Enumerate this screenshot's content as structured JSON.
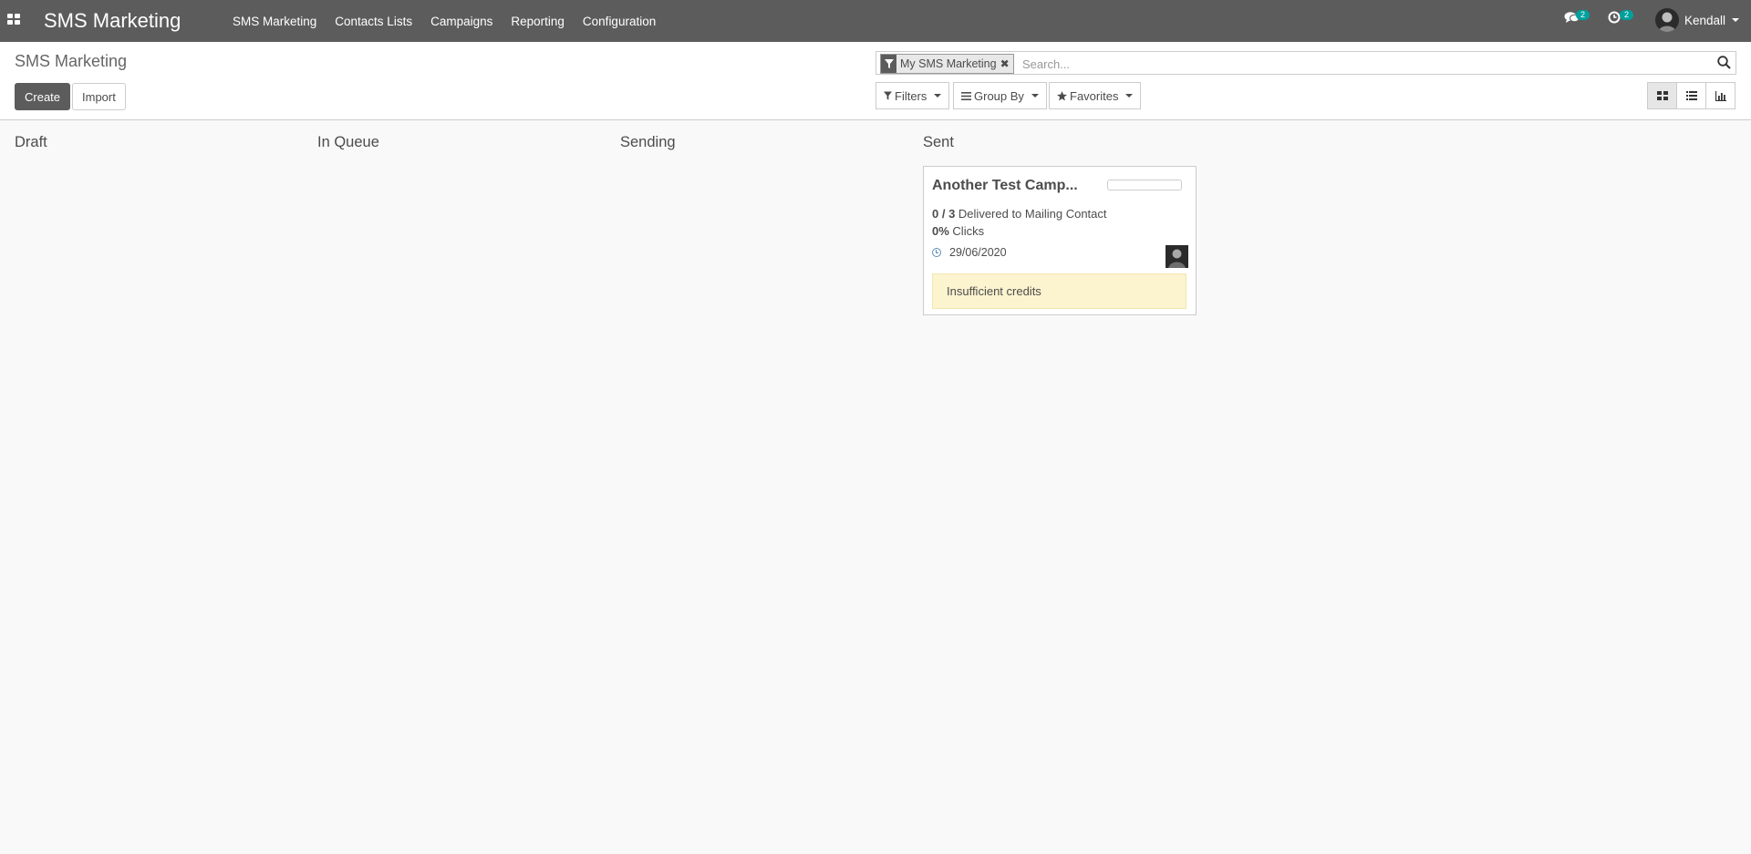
{
  "navbar": {
    "app_name": "SMS Marketing",
    "menu": [
      "SMS Marketing",
      "Contacts Lists",
      "Campaigns",
      "Reporting",
      "Configuration"
    ],
    "messages_count": "2",
    "activities_count": "2",
    "user_name": "Kendall",
    "icons": [
      "apps-icon",
      "chat-icon",
      "clock-icon",
      "avatar",
      "chevron-down-icon"
    ]
  },
  "control_panel": {
    "breadcrumb": "SMS Marketing",
    "create_label": "Create",
    "import_label": "Import",
    "search": {
      "facet_label": "My SMS Marketing",
      "placeholder": "Search..."
    },
    "filters_label": "Filters",
    "group_by_label": "Group By",
    "favorites_label": "Favorites",
    "views": [
      "kanban",
      "list",
      "graph"
    ],
    "active_view": "kanban"
  },
  "kanban": {
    "columns": [
      "Draft",
      "In Queue",
      "Sending",
      "Sent"
    ],
    "card": {
      "title": "Another Test Camp...",
      "delivered_count": "0 / 3",
      "delivered_text": "Delivered to Mailing Contact",
      "clicks_value": "0%",
      "clicks_text": "Clicks",
      "date": "29/06/2020",
      "warning": "Insufficient credits",
      "progress": 0
    }
  },
  "colors": {
    "navbar_bg": "#5c5c5c",
    "badge": "#00a09d",
    "warning_bg": "#fcf3cf"
  }
}
